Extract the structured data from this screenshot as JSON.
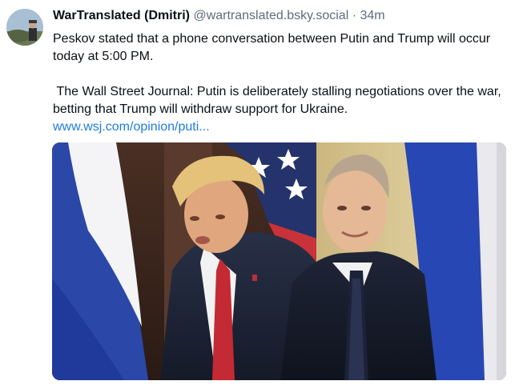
{
  "post": {
    "display_name": "WarTranslated (Dmitri)",
    "handle": "@wartranslated.bsky.social",
    "separator": "·",
    "time": "34m",
    "paragraph_1": "Peskov stated that a phone conversation between Putin and Trump will occur today at 5:00 PM.",
    "paragraph_2": " The Wall Street Journal: Putin is deliberately stalling negotiations over the war, betting that Trump will withdraw support for Ukraine.",
    "link_text": "www.wsj.com/opinion/puti..."
  },
  "media": {
    "type": "photo",
    "alt_icon": "photo-of-two-men-with-flags"
  },
  "colors": {
    "link": "#1f7ce0",
    "muted": "#5e6c7c",
    "text": "#0b0f14"
  }
}
